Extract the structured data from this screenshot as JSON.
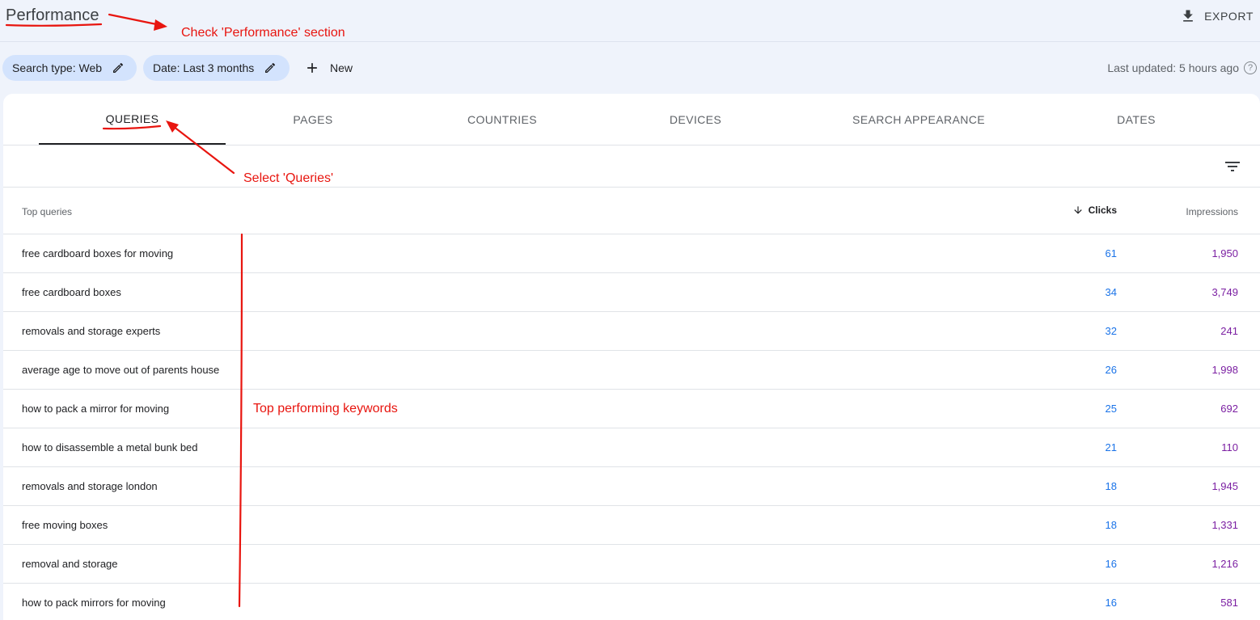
{
  "header": {
    "title": "Performance",
    "export_label": "EXPORT"
  },
  "filters": {
    "search_type_chip": "Search type: Web",
    "date_chip": "Date: Last 3 months",
    "new_label": "New",
    "last_updated": "Last updated: 5 hours ago",
    "help_glyph": "?"
  },
  "tabs": [
    {
      "label": "QUERIES",
      "active": true
    },
    {
      "label": "PAGES",
      "active": false
    },
    {
      "label": "COUNTRIES",
      "active": false
    },
    {
      "label": "DEVICES",
      "active": false
    },
    {
      "label": "SEARCH APPEARANCE",
      "active": false
    },
    {
      "label": "DATES",
      "active": false
    }
  ],
  "table": {
    "headers": {
      "query": "Top queries",
      "clicks": "Clicks",
      "impressions": "Impressions"
    },
    "sort": {
      "column": "clicks",
      "direction": "descending"
    },
    "rows": [
      {
        "query": "free cardboard boxes for moving",
        "clicks": "61",
        "impressions": "1,950"
      },
      {
        "query": "free cardboard boxes",
        "clicks": "34",
        "impressions": "3,749"
      },
      {
        "query": "removals and storage experts",
        "clicks": "32",
        "impressions": "241"
      },
      {
        "query": "average age to move out of parents house",
        "clicks": "26",
        "impressions": "1,998"
      },
      {
        "query": "how to pack a mirror for moving",
        "clicks": "25",
        "impressions": "692"
      },
      {
        "query": "how to disassemble a metal bunk bed",
        "clicks": "21",
        "impressions": "110"
      },
      {
        "query": "removals and storage london",
        "clicks": "18",
        "impressions": "1,945"
      },
      {
        "query": "free moving boxes",
        "clicks": "18",
        "impressions": "1,331"
      },
      {
        "query": "removal and storage",
        "clicks": "16",
        "impressions": "1,216"
      },
      {
        "query": "how to pack mirrors for moving",
        "clicks": "16",
        "impressions": "581"
      }
    ]
  },
  "annotations": {
    "performance_note": "Check 'Performance' section",
    "queries_note": "Select 'Queries'",
    "keywords_note": "Top performing keywords"
  },
  "colors": {
    "background": "#eff3fb",
    "chip": "#d3e3fd",
    "clicks": "#1a73e8",
    "impressions": "#7b1fa2",
    "annotation": "#e8150f"
  },
  "icons": {
    "export": "download-icon",
    "edit": "pencil-icon",
    "new": "plus-icon",
    "help": "help-circle-icon",
    "filter": "filter-list-icon",
    "sort": "arrow-down-icon"
  }
}
